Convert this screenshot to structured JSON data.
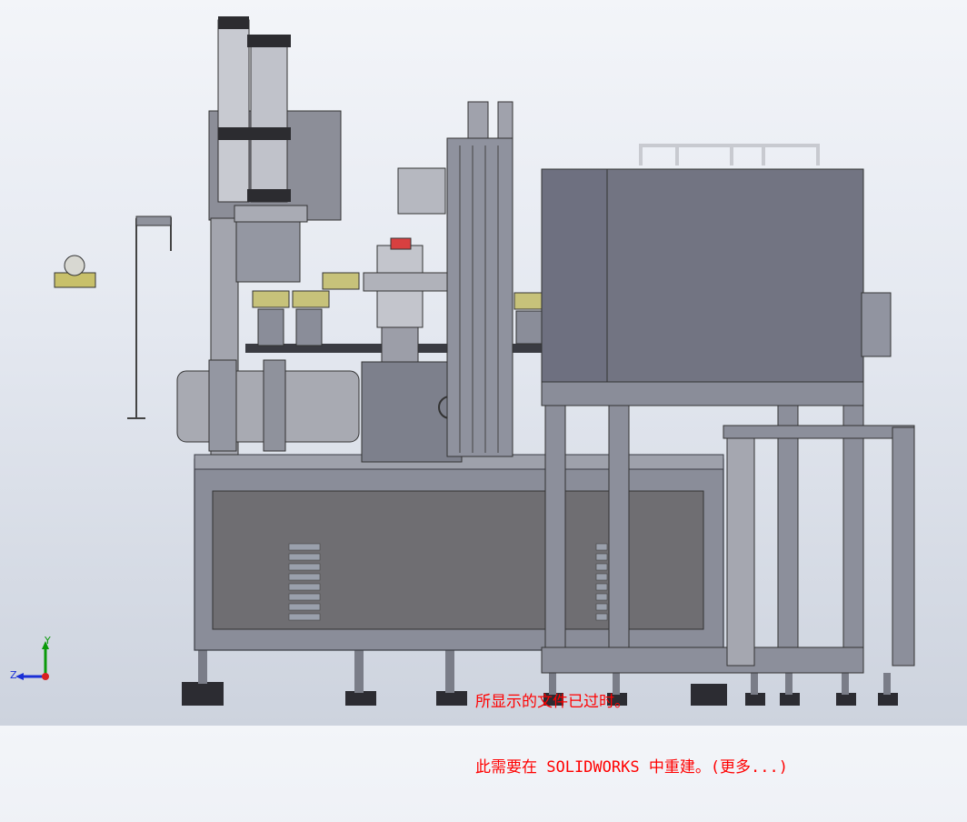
{
  "app": "SOLIDWORKS",
  "notice": {
    "line1": "所显示的文件已过时。",
    "line2": "此需要在 SOLIDWORKS 中重建。(更多...)"
  },
  "triad": {
    "x": "",
    "y": "Y",
    "z": "Z"
  },
  "colors": {
    "body": "#8a8d99",
    "body_dark": "#5d6070",
    "panel": "#7b7e8c",
    "frame": "#9a9ca6",
    "cabinet": "#6f717b",
    "cylinder": "#b9bbc3",
    "notice": "#ff0000"
  },
  "icons": [
    "axis-triad-icon"
  ]
}
